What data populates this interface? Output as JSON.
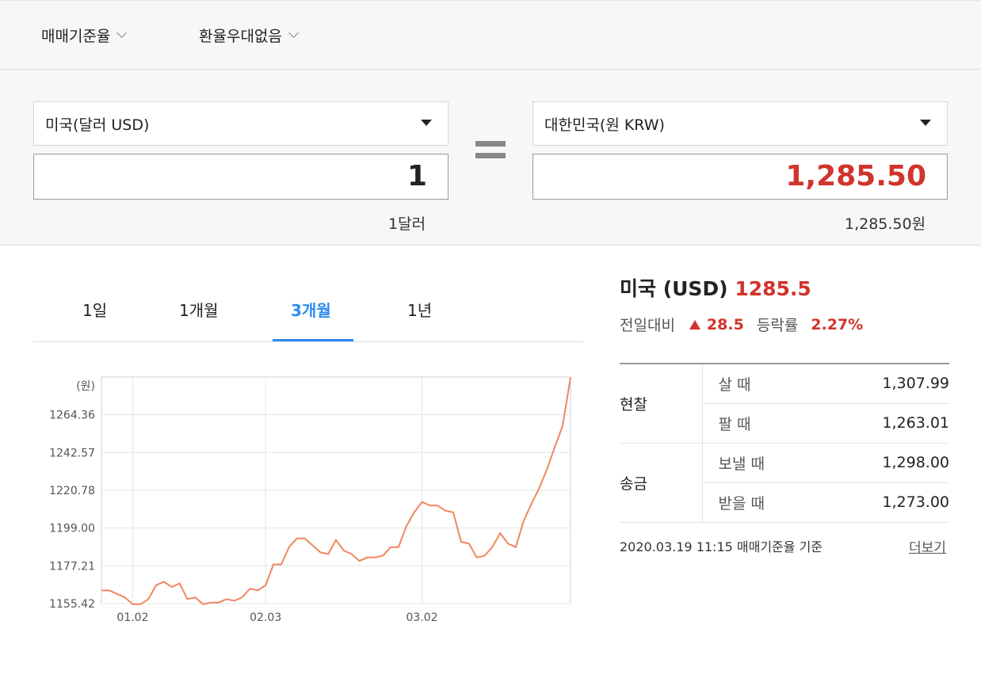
{
  "options": {
    "rate_type": "매매기준율",
    "discount": "환율우대없음"
  },
  "converter": {
    "from_currency": "미국(달러 USD)",
    "from_amount": "1",
    "from_note": "1달러",
    "to_currency": "대한민국(원 KRW)",
    "to_amount": "1,285.50",
    "to_note": "1,285.50원"
  },
  "tabs": [
    "1일",
    "1개월",
    "3개월",
    "1년"
  ],
  "active_tab": "3개월",
  "summary": {
    "country": "미국 (USD)",
    "value": "1285.5",
    "change_label": "전일대비",
    "change": "28.5",
    "rate_label": "등락률",
    "rate": "2.27%"
  },
  "rates": [
    {
      "category": "현찰",
      "rows": [
        {
          "label": "살 때",
          "value": "1,307.99"
        },
        {
          "label": "팔 때",
          "value": "1,263.01"
        }
      ]
    },
    {
      "category": "송금",
      "rows": [
        {
          "label": "보낼 때",
          "value": "1,298.00"
        },
        {
          "label": "받을 때",
          "value": "1,273.00"
        }
      ]
    }
  ],
  "basis": "2020.03.19 11:15  매매기준율 기준",
  "more": "더보기",
  "colors": {
    "accent": "#2d8cf0",
    "up": "#d0342c",
    "line": "#f08660"
  },
  "chart_data": {
    "type": "line",
    "unit_label": "(원)",
    "y_ticks": [
      "1264.36",
      "1242.57",
      "1220.78",
      "1199.00",
      "1177.21",
      "1155.42"
    ],
    "x_ticks": [
      "01.02",
      "02.03",
      "03.02"
    ],
    "ylim": [
      1155.42,
      1286.1
    ],
    "series": [
      {
        "values": [
          1163,
          1163,
          1161,
          1159,
          1155,
          1155,
          1158,
          1166,
          1168,
          1165,
          1167,
          1158,
          1159,
          1155,
          1156,
          1156,
          1158,
          1157,
          1159,
          1164,
          1163,
          1166,
          1178,
          1178,
          1188,
          1193,
          1193,
          1189,
          1185,
          1184,
          1192,
          1186,
          1184,
          1180,
          1182,
          1182,
          1183,
          1188,
          1188,
          1200,
          1208,
          1214,
          1212,
          1212,
          1209,
          1208,
          1191,
          1190,
          1182,
          1183,
          1188,
          1196,
          1190,
          1188,
          1203,
          1213,
          1222,
          1233,
          1246,
          1258,
          1286
        ]
      }
    ]
  }
}
